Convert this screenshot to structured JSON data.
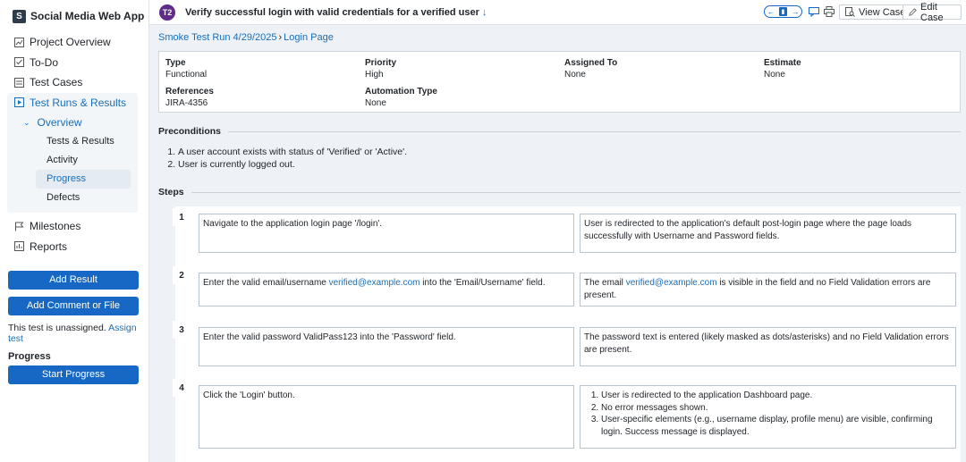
{
  "app": {
    "logo_letter": "S",
    "title": "Social Media Web App"
  },
  "sidebar": {
    "items": [
      {
        "label": "Project Overview",
        "icon": "chart-icon"
      },
      {
        "label": "To-Do",
        "icon": "checkbox-icon"
      },
      {
        "label": "Test Cases",
        "icon": "list-icon"
      },
      {
        "label": "Test Runs & Results",
        "icon": "play-square-icon"
      }
    ],
    "overview_label": "Overview",
    "sub_items": [
      "Tests & Results",
      "Activity",
      "Progress",
      "Defects"
    ],
    "items_after": [
      {
        "label": "Milestones",
        "icon": "flag-icon"
      },
      {
        "label": "Reports",
        "icon": "report-icon"
      }
    ],
    "add_result": "Add Result",
    "add_comment": "Add Comment or File",
    "unassigned_text": "This test is unassigned.",
    "assign_link": "Assign test",
    "progress_heading": "Progress",
    "start_progress": "Start Progress"
  },
  "topbar": {
    "badge": "T2",
    "title": "Verify successful login with valid credentials for a verified user",
    "view_case": "View Case",
    "edit_case": "Edit Case"
  },
  "breadcrumb": {
    "run": "Smoke Test Run 4/29/2025",
    "sep": "›",
    "section": "Login Page"
  },
  "info": {
    "type_label": "Type",
    "type_value": "Functional",
    "priority_label": "Priority",
    "priority_value": "High",
    "assigned_label": "Assigned To",
    "assigned_value": "None",
    "estimate_label": "Estimate",
    "estimate_value": "None",
    "references_label": "References",
    "references_value": "JIRA-4356",
    "automation_label": "Automation Type",
    "automation_value": "None"
  },
  "preconditions": {
    "heading": "Preconditions",
    "items": [
      "A user account exists with status of 'Verified' or 'Active'.",
      "User is currently logged out."
    ]
  },
  "steps": {
    "heading": "Steps",
    "list": [
      {
        "num": "1",
        "action": "Navigate to the application login page '/login'.",
        "expected": "User is redirected to the application's default post-login page where the page loads successfully with Username and Password fields."
      },
      {
        "num": "2",
        "action_pre": "Enter the valid email/username ",
        "action_link": "verified@example.com",
        "action_post": " into the 'Email/Username' field.",
        "expected_pre": "The email ",
        "expected_link": "verified@example.com",
        "expected_post": " is visible in the field and no Field Validation errors are present."
      },
      {
        "num": "3",
        "action": "Enter the valid password ValidPass123 into the 'Password' field.",
        "expected": "The password text is entered (likely masked as dots/asterisks) and no Field Validation errors are present."
      },
      {
        "num": "4",
        "action": "Click the 'Login' button.",
        "expected_items": [
          "User is redirected to the application Dashboard page.",
          "No error messages shown.",
          "User-specific elements (e.g., username display, profile menu) are visible, confirming login. Success message is displayed."
        ]
      }
    ]
  },
  "colors": {
    "primary": "#1668c4",
    "link": "#1b6db5",
    "badge": "#5f2c8a",
    "background": "#eef2f6"
  }
}
